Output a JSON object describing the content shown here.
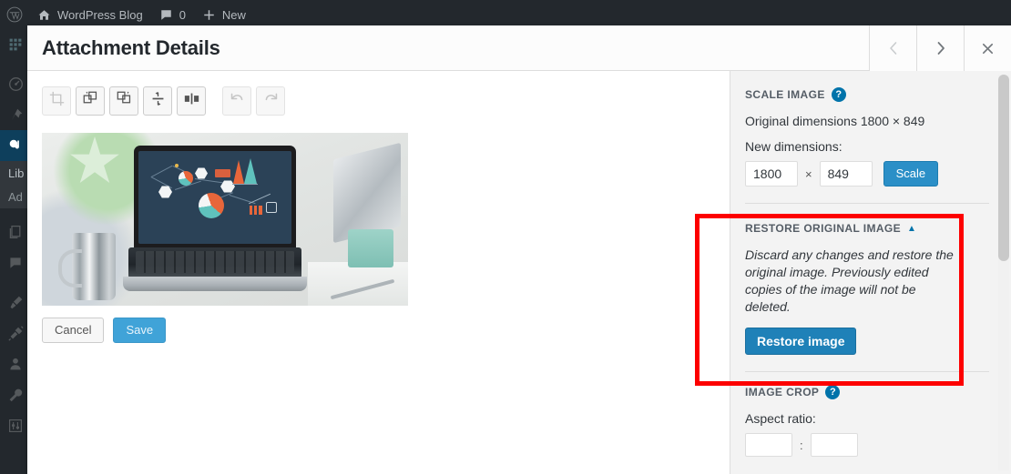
{
  "adminbar": {
    "logo_icon": "wordpress-logo-icon",
    "items": [
      {
        "icon": "home-icon",
        "label": "WordPress Blog"
      },
      {
        "icon": "comment-bubble-icon",
        "label": "0"
      },
      {
        "icon": "plus-icon",
        "label": "New"
      }
    ]
  },
  "adminmenu": {
    "items": [
      {
        "icon": "dashboard-grid-icon",
        "name": "sidebar-item-grid"
      },
      {
        "icon": "gauge-icon",
        "name": "sidebar-item-dashboard"
      },
      {
        "icon": "pin-icon",
        "name": "sidebar-item-posts"
      },
      {
        "icon": "media-icon",
        "name": "sidebar-item-media",
        "current": true
      },
      {
        "icon": "pages-icon",
        "name": "sidebar-item-pages"
      },
      {
        "icon": "comments-icon",
        "name": "sidebar-item-comments"
      },
      {
        "icon": "brush-icon",
        "name": "sidebar-item-appearance"
      },
      {
        "icon": "plug-icon",
        "name": "sidebar-item-plugins"
      },
      {
        "icon": "user-icon",
        "name": "sidebar-item-users"
      },
      {
        "icon": "wrench-icon",
        "name": "sidebar-item-tools"
      },
      {
        "icon": "sliders-icon",
        "name": "sidebar-item-settings"
      }
    ],
    "submenu": [
      {
        "label": "Lib"
      },
      {
        "label": "Ad"
      }
    ]
  },
  "modal": {
    "title": "Attachment Details",
    "nav": {
      "prev_icon": "chevron-left-icon",
      "next_icon": "chevron-right-icon",
      "close_icon": "close-x-icon"
    }
  },
  "toolbar": {
    "buttons": [
      {
        "name": "crop-button",
        "icon": "crop-icon",
        "disabled": true
      },
      {
        "name": "rotate-left-button",
        "icon": "rotate-counterclockwise-icon",
        "disabled": false
      },
      {
        "name": "rotate-right-button",
        "icon": "rotate-clockwise-icon",
        "disabled": false
      },
      {
        "name": "flip-vertical-button",
        "icon": "flip-vertical-icon",
        "disabled": false
      },
      {
        "name": "flip-horizontal-button",
        "icon": "flip-horizontal-icon",
        "disabled": false
      },
      {
        "name": "undo-button",
        "icon": "undo-arrow-icon",
        "disabled": true
      },
      {
        "name": "redo-button",
        "icon": "redo-arrow-icon",
        "disabled": true
      }
    ]
  },
  "image": {
    "alt": "Laptop on desk displaying data visualization dashboard"
  },
  "actions": {
    "cancel_label": "Cancel",
    "save_label": "Save"
  },
  "scale_image": {
    "heading": "SCALE IMAGE",
    "help_icon": "help-question-icon",
    "original_dimensions": "Original dimensions 1800 × 849",
    "new_dimensions_label": "New dimensions:",
    "width_value": "1800",
    "separator": "×",
    "height_value": "849",
    "scale_button": "Scale"
  },
  "restore_original": {
    "heading": "RESTORE ORIGINAL IMAGE",
    "toggle_icon": "caret-up-icon",
    "description": "Discard any changes and restore the original image. Previously edited copies of the image will not be deleted.",
    "restore_button": "Restore image",
    "highlight_color": "#fd0000"
  },
  "image_crop": {
    "heading": "IMAGE CROP",
    "help_icon": "help-question-icon",
    "aspect_ratio_label": "Aspect ratio:",
    "ratio_width": "",
    "ratio_separator": ":",
    "ratio_height": ""
  },
  "colors": {
    "accent_blue": "#2b8fc7",
    "restore_blue": "#1f81b8",
    "admin_dark": "#23282d",
    "highlight_red": "#fd0000"
  }
}
